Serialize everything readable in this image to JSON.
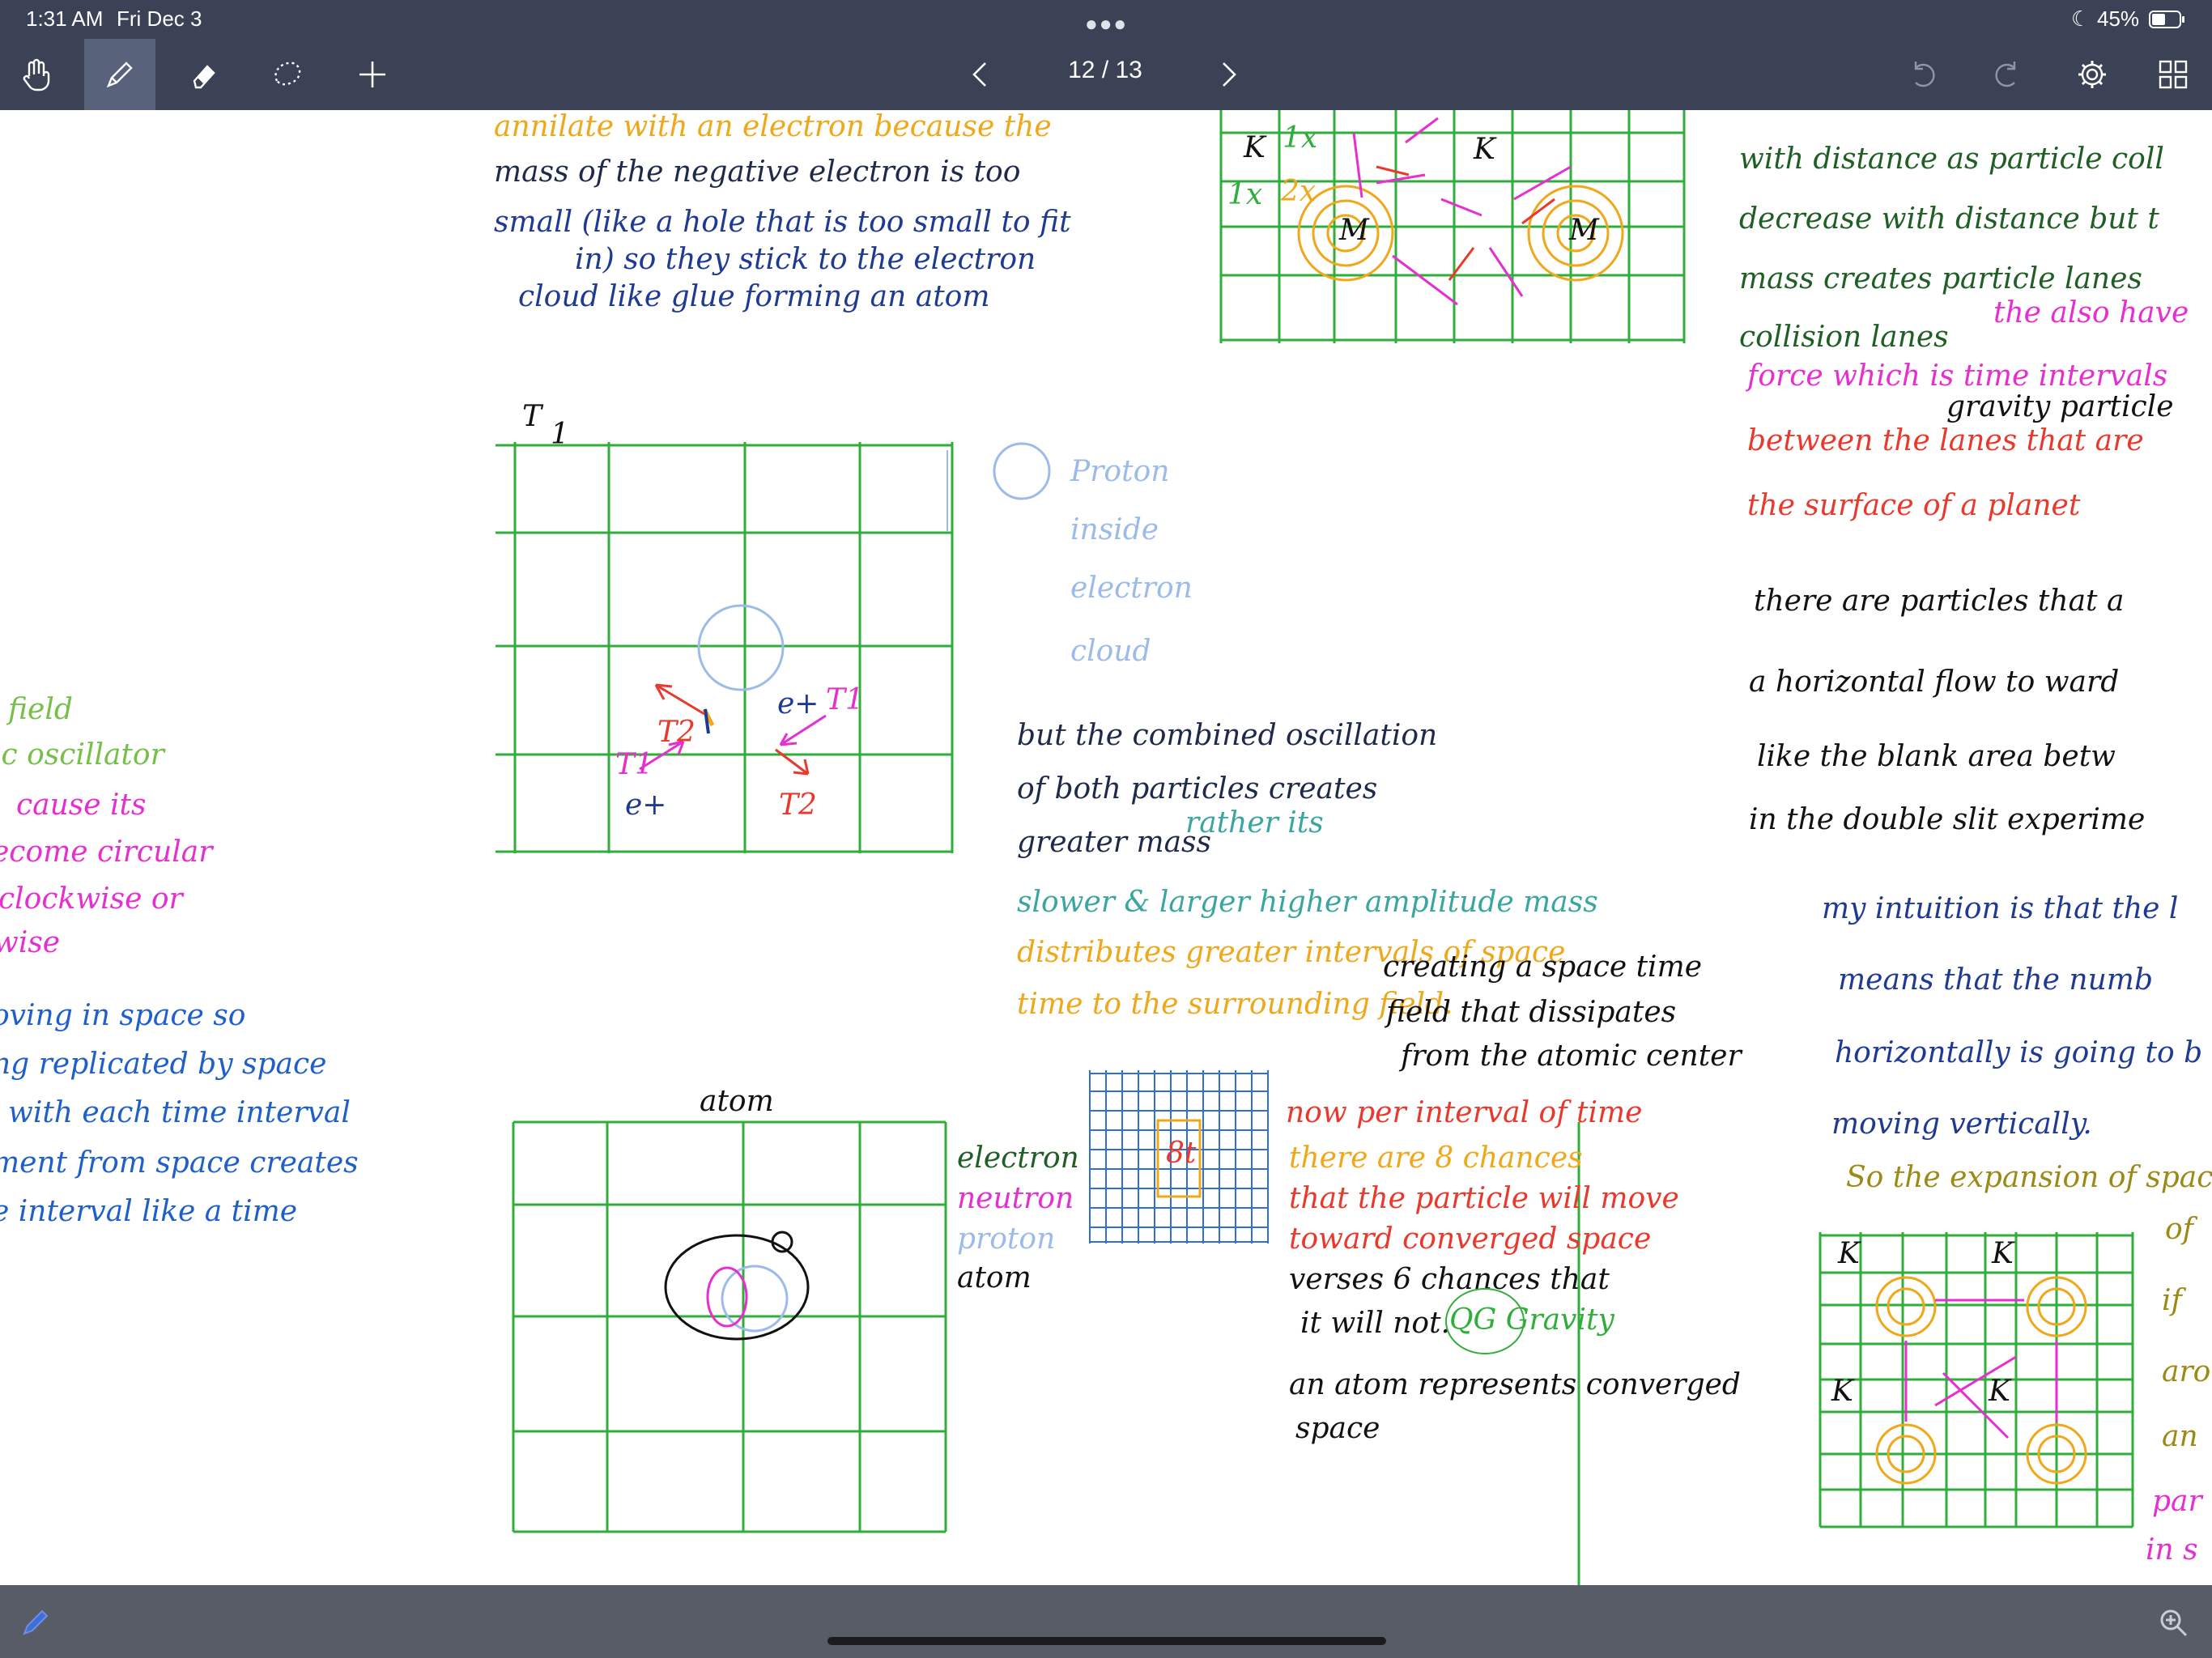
{
  "status_bar": {
    "time": "1:31 AM",
    "date": "Fri Dec 3",
    "battery": "45%",
    "icons": [
      "moon-icon",
      "battery-icon"
    ]
  },
  "toolbar": {
    "tools": [
      "hand-icon",
      "pen-icon",
      "eraser-icon",
      "lasso-icon",
      "plus-icon"
    ],
    "active_tool": "pen-icon",
    "page_indicator": "12 / 13",
    "right_icons": [
      "undo-icon",
      "redo-icon",
      "gear-icon",
      "grid-icon"
    ]
  },
  "colors": {
    "bar": "#3b4256",
    "grid_green": "#2fae3a",
    "ink_blue": "#1f3a93",
    "ink_magenta": "#e62fd0",
    "ink_orange": "#f0a81b",
    "ink_red": "#e8392c",
    "ink_teal": "#3aa6a0",
    "ink_lightblue": "#9cbbe8",
    "ink_black": "#111111",
    "ink_darkgreen": "#1f5e25",
    "ink_olive": "#9c8a16"
  },
  "notes": {
    "top_left": [
      "annilate with an electron because the",
      "mass of the negative electron is too",
      "small (like a hole that is too small to fit",
      "in) so they stick to the electron",
      "cloud like glue forming an atom"
    ],
    "t1_label": "T",
    "t1_sub": "1",
    "diagram1": {
      "e1": "e+",
      "e2": "e+",
      "t1a": "T1",
      "t1b": "T1",
      "t2a": "T2",
      "t2b": "T2"
    },
    "proton_note": [
      "Proton",
      "inside",
      "electron",
      "cloud"
    ],
    "middle_note": [
      "but the combined oscillation",
      "of both particles creates",
      "greater mass",
      "rather its",
      "slower & larger higher amplitude mass",
      "distributes greater intervals of space",
      "time to the surrounding field.",
      "creating a space time",
      "field that dissipates",
      "from the atomic center"
    ],
    "atom_title": "atom",
    "legend": [
      "electron",
      "neutron",
      "proton",
      "atom"
    ],
    "small_grid_label": "8t",
    "k_label": "K",
    "m_label": "M",
    "x_label": "1x",
    "x2_label": "2x",
    "chances_note": [
      "now per interval of time",
      "there are 8 chances",
      "that the particle will move",
      "toward converged space",
      "verses 6 chances that",
      "it will not.",
      "QG Gravity",
      "an atom represents converged",
      "space"
    ],
    "left_edge": [
      "field",
      "ic oscillator",
      "cause its",
      "ecome circular",
      "clockwise or",
      "wise",
      "oving in space so",
      "ng replicated by space",
      "with each time interval",
      "ment from space creates",
      "e interval like a time"
    ],
    "right_column": [
      "with distance as particle coll",
      "decrease with distance but t",
      "mass creates particle lanes",
      "collision lanes",
      "the also have",
      "force which is time intervals",
      "gravity particle",
      "between the lanes that are",
      "the surface of a planet",
      "there are particles that a",
      "a horizontal flow to ward",
      "like the blank area betw",
      "in the double slit experime",
      "my intuition is that the l",
      "means that the numb",
      "horizontally is going to b",
      "moving vertically.",
      "So the expansion of space",
      "of",
      "if",
      "aro",
      "an",
      "par",
      "in s"
    ]
  }
}
